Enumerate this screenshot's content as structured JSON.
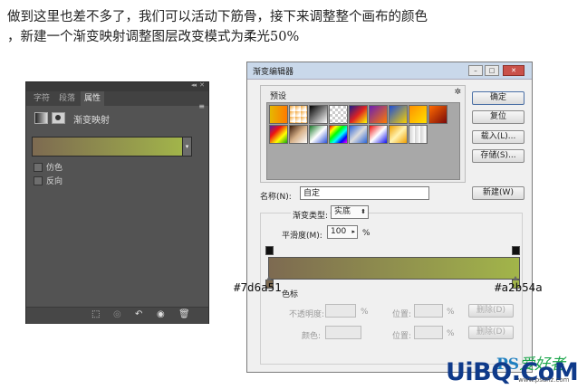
{
  "intro": {
    "line1": "做到这里也差不多了，我们可以活动下筋骨，接下来调整整个画布的颜色",
    "line2": "，新建一个渐变映射调整图层改变模式为柔光50%"
  },
  "ps_panel": {
    "collapse": "◂◂",
    "close": "✕",
    "tabs": [
      {
        "label": "字符"
      },
      {
        "label": "段落"
      },
      {
        "label": "属性"
      }
    ],
    "menu": "≡",
    "adj_name": "渐变映射",
    "gradient_from": "#7d6a51",
    "gradient_to": "#a2b54a",
    "checkboxes": [
      {
        "label": "仿色"
      },
      {
        "label": "反向"
      }
    ],
    "bottom_icons": [
      "clip-icon",
      "eye-link-icon",
      "undo-icon",
      "visibility-icon",
      "trash-icon"
    ]
  },
  "dialog": {
    "title": "渐变编辑器",
    "presets_label": "预设",
    "buttons": {
      "ok": "确定",
      "reset": "复位",
      "load": "载入(L)...",
      "save": "存储(S)...",
      "new": "新建(W)"
    },
    "name_label": "名称(N):",
    "name_value": "自定",
    "type_label": "渐变类型:",
    "type_value": "实底",
    "smooth_label": "平滑度(M):",
    "smooth_value": "100",
    "smooth_unit": "%",
    "color_stop_section": "色标",
    "opacity_label": "不透明度:",
    "opacity_unit": "%",
    "position_label": "位置:",
    "position_unit": "%",
    "delete_label": "删除(D)",
    "color_label": "颜色:",
    "stop_left_hex": "#7d6a51",
    "stop_right_hex": "#a2b54a"
  },
  "watermark": {
    "logo_ps": "PS",
    "logo_text": "爱好者",
    "site": "UiBQ.CoM",
    "site_sub": "www.psahz.com"
  }
}
